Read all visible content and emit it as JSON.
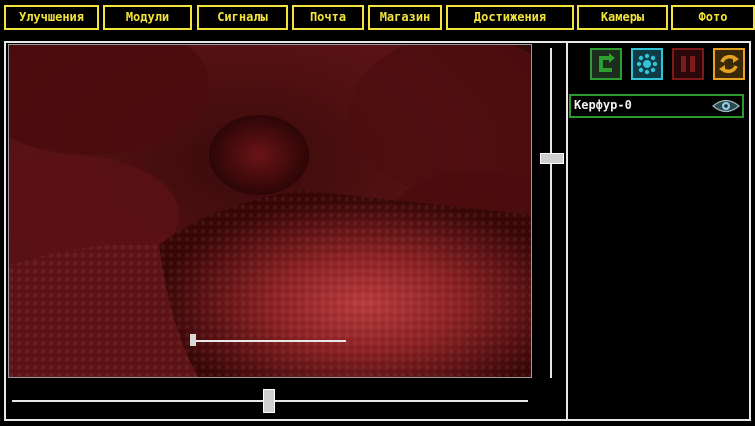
{
  "nav": {
    "tabs": [
      {
        "label": "Улучшения"
      },
      {
        "label": "Модули"
      },
      {
        "label": "Сигналы"
      },
      {
        "label": "Почта"
      },
      {
        "label": "Магазин"
      },
      {
        "label": "Достижения"
      },
      {
        "label": "Камеры"
      },
      {
        "label": "Фото"
      }
    ],
    "accent_color": "#f2e43a"
  },
  "controls": {
    "buttons": [
      {
        "icon": "refresh-arrow-icon",
        "color": "#2e9e2e"
      },
      {
        "icon": "dots-grid-icon",
        "color": "#2fc4d8"
      },
      {
        "icon": "pause-icon",
        "color": "#7a1a1a"
      },
      {
        "icon": "rotate-icon",
        "color": "#e5a324"
      }
    ]
  },
  "cameras": {
    "items": [
      {
        "label": "Керфур-0",
        "selected": true,
        "icon": "eye-icon"
      }
    ]
  },
  "view": {
    "vertical_slider": 0.33,
    "horizontal_slider": 0.5,
    "inner_slider": 0.0
  }
}
